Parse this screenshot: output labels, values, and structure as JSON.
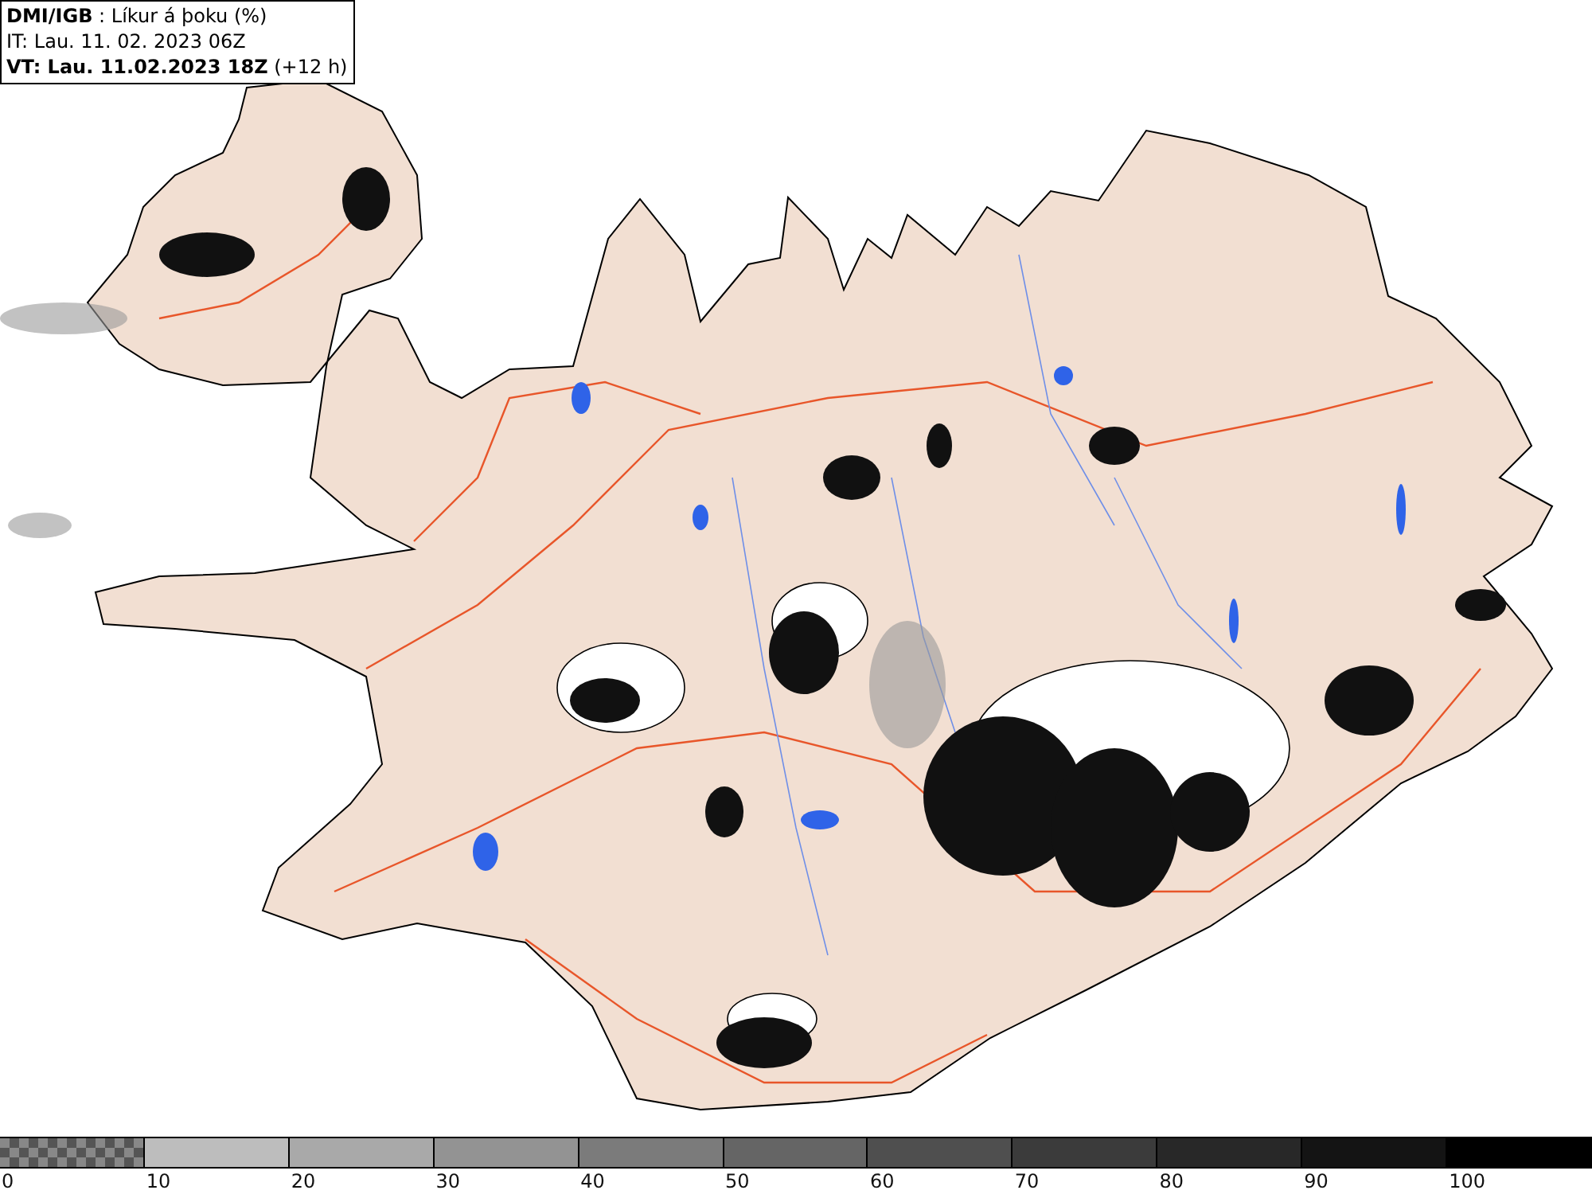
{
  "header": {
    "lines": [
      "**DMI/IGB** : Líkur á þoku (%)",
      "IT: Lau. 11. 02. 2023 06Z",
      "**VT: Lau. 11.02.2023 18Z** (+12 h)"
    ]
  },
  "legend": {
    "segments": [
      {
        "kind": "checker",
        "label": "0"
      },
      {
        "kind": "solid",
        "color": "#bdbdbd",
        "label": "10"
      },
      {
        "kind": "solid",
        "color": "#a9a9a9",
        "label": "20"
      },
      {
        "kind": "solid",
        "color": "#939393",
        "label": "30"
      },
      {
        "kind": "solid",
        "color": "#7b7b7b",
        "label": "40"
      },
      {
        "kind": "solid",
        "color": "#656565",
        "label": "50"
      },
      {
        "kind": "solid",
        "color": "#4f4f4f",
        "label": "60"
      },
      {
        "kind": "solid",
        "color": "#3b3b3b",
        "label": "70"
      },
      {
        "kind": "solid",
        "color": "#282828",
        "label": "80"
      },
      {
        "kind": "solid",
        "color": "#141414",
        "label": "90"
      },
      {
        "kind": "solid",
        "color": "#000000",
        "label": "100"
      }
    ]
  }
}
